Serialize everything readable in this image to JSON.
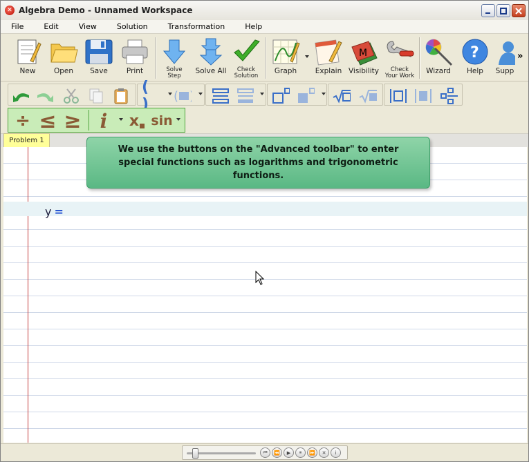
{
  "window": {
    "title": "Algebra Demo - Unnamed Workspace"
  },
  "menu": [
    "File",
    "Edit",
    "View",
    "Solution",
    "Transformation",
    "Help"
  ],
  "toolbar_main": {
    "new": "New",
    "open": "Open",
    "save": "Save",
    "print": "Print",
    "solve_step": "Solve Step",
    "solve_all": "Solve All",
    "check_solution": "Check Solution",
    "graph": "Graph",
    "explain": "Explain",
    "visibility": "Visibility",
    "check_your_work": "Check Your Work",
    "wizard": "Wizard",
    "help": "Help",
    "support": "Supp",
    "overflow": "»"
  },
  "toolbar_advanced": {
    "divide": "÷",
    "less_equal": "≤",
    "greater_equal": "≥",
    "info": "i",
    "subscript": "x",
    "sin": "sin"
  },
  "tab": {
    "label": "Problem 1"
  },
  "tooltip": {
    "text": "We use the buttons on the \"Advanced toolbar\" to enter special functions such as logarithms and trigonometric functions."
  },
  "equation": {
    "lhs": "y",
    "eq": "="
  },
  "colors": {
    "advanced_toolbar_bg": "#c9ecb8",
    "tooltip_bg": "#6fc491",
    "margin_line": "#c23b3b",
    "tab_bg": "#ffff99"
  }
}
